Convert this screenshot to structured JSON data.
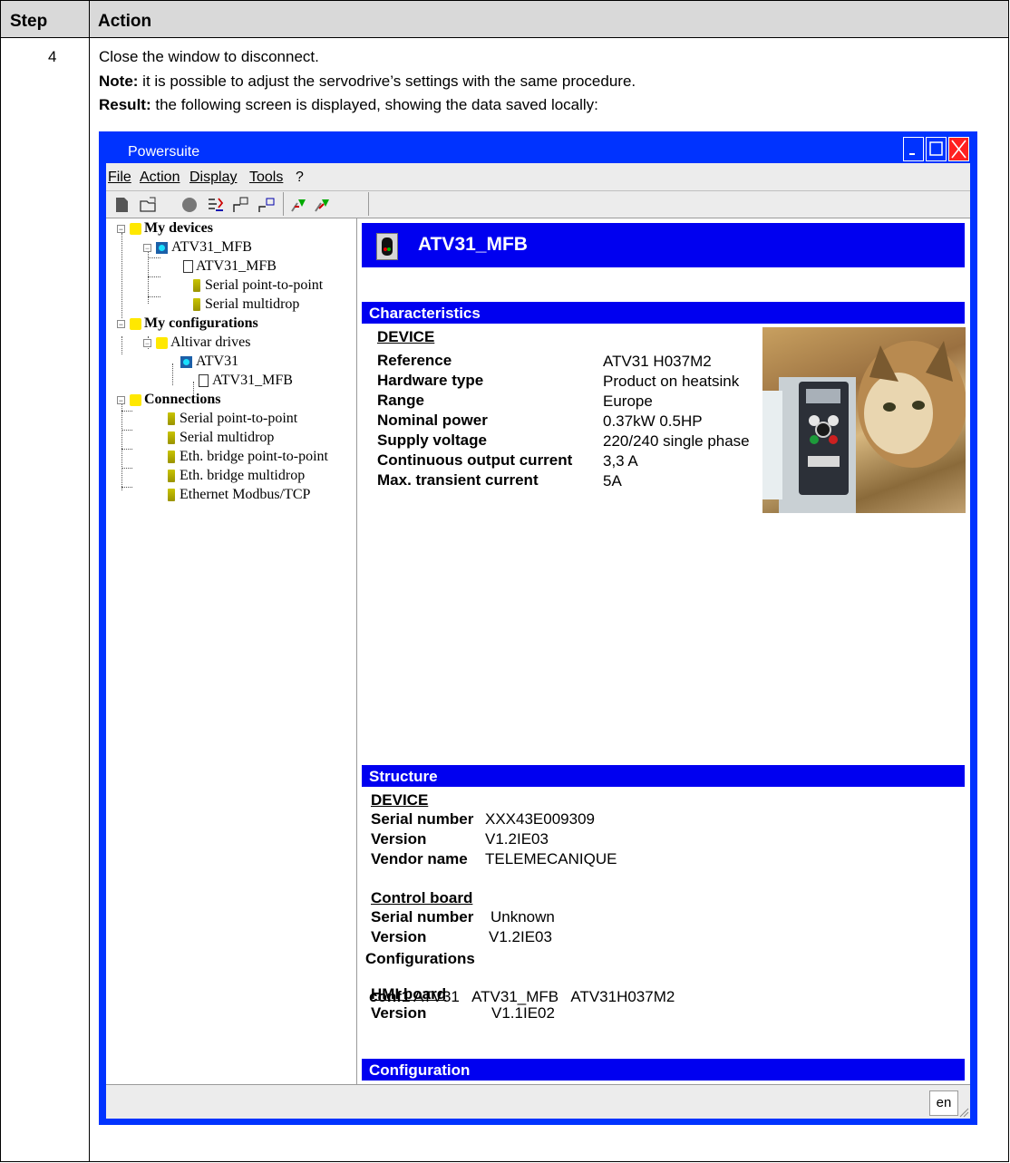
{
  "table": {
    "step_header": "Step",
    "action_header": "Action",
    "step_number": "4",
    "line1": "Close the window to disconnect.",
    "note_label": "Note:",
    "note_text": " it is possible to adjust the servodrive’s settings with the same procedure.",
    "result_label": "Result:",
    "result_text": " the following screen is displayed, showing the data saved locally:"
  },
  "window": {
    "title": "Powersuite",
    "menu": {
      "file": "File",
      "action": "Action",
      "display": "Display",
      "tools": "Tools",
      "help": "?"
    },
    "status_lang": "en"
  },
  "tree": {
    "my_devices": "My devices",
    "device": "ATV31_MFB",
    "device_child": "ATV31_MFB",
    "dev_serial_p2p": "Serial point-to-point",
    "dev_serial_multidrop": "Serial multidrop",
    "my_configurations": "My configurations",
    "altivar_drives": "Altivar drives",
    "atv31": "ATV31",
    "atv31_child": "ATV31_MFB",
    "connections": "Connections",
    "conn_serial_p2p": "Serial point-to-point",
    "conn_serial_multidrop": "Serial multidrop",
    "conn_eth_p2p": "Eth. bridge point-to-point",
    "conn_eth_multidrop": "Eth. bridge multidrop",
    "conn_modbus": "Ethernet Modbus/TCP"
  },
  "panel": {
    "device_title": "ATV31_MFB",
    "characteristics": {
      "heading": "Characteristics",
      "device_label": "DEVICE",
      "rows": [
        {
          "label": "Reference",
          "value": "ATV31 H037M2"
        },
        {
          "label": "Hardware type",
          "value": "Product on heatsink"
        },
        {
          "label": "Range",
          "value": "Europe"
        },
        {
          "label": "Nominal power",
          "value": "0.37kW 0.5HP"
        },
        {
          "label": "Supply voltage",
          "value": "220/240 single phase"
        },
        {
          "label": "Continuous output current",
          "value": "3,3 A"
        },
        {
          "label": "Max. transient current",
          "value": "5A"
        }
      ]
    },
    "structure": {
      "heading": "Structure",
      "device_label": "DEVICE",
      "serial_label": "Serial number",
      "serial_value": "XXX43E009309",
      "version_label": "Version",
      "version_value": "V1.2IE03",
      "vendor_label": "Vendor name",
      "vendor_value": "TELEMECANIQUE",
      "control_board": "Control board",
      "cb_serial_label": "Serial number",
      "cb_serial_value": "Unknown",
      "cb_version_label": "Version",
      "cb_version_value": "V1.2IE03",
      "hmi_board": "HMI board",
      "hmi_version_label": "Version",
      "hmi_version_value": "V1.1IE02"
    },
    "configuration": {
      "heading": "Configuration",
      "configurations_label": "Configurations",
      "conf_name": "conf1",
      "conf_values": "ATV31   ATV31_MFB   ATV31H037M2"
    }
  },
  "colors": {
    "window_frame": "#0033ff",
    "section_bar": "#0000f0",
    "close_button": "#ff2020",
    "folder": "#ffe800"
  }
}
